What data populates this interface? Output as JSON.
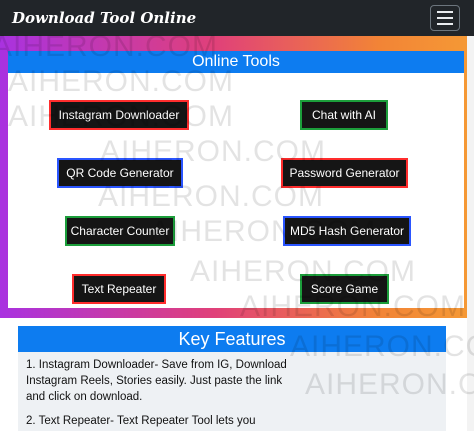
{
  "navbar": {
    "brand": "Download Tool Online"
  },
  "tools": {
    "title": "Online Tools",
    "buttons": [
      {
        "label": "Instagram Downloader",
        "border": "#ff2d2d"
      },
      {
        "label": "Chat with AI",
        "border": "#1c9e3b"
      },
      {
        "label": "QR Code Generator",
        "border": "#2a55ff"
      },
      {
        "label": "Password Generator",
        "border": "#ff2d2d"
      },
      {
        "label": "Character Counter",
        "border": "#1c9e3b"
      },
      {
        "label": "MD5 Hash Generator",
        "border": "#2a55ff"
      },
      {
        "label": "Text Repeater",
        "border": "#ff2d2d"
      },
      {
        "label": "Score Game",
        "border": "#1c9e3b"
      }
    ]
  },
  "features": {
    "title": "Key Features",
    "items": [
      "1. Instagram Downloader- Save from IG, Download Instagram Reels, Stories easily. Just paste the link and click on download.",
      "2. Text Repeater- Text Repeater Tool lets you"
    ]
  },
  "watermark": "AIHERON.COM"
}
